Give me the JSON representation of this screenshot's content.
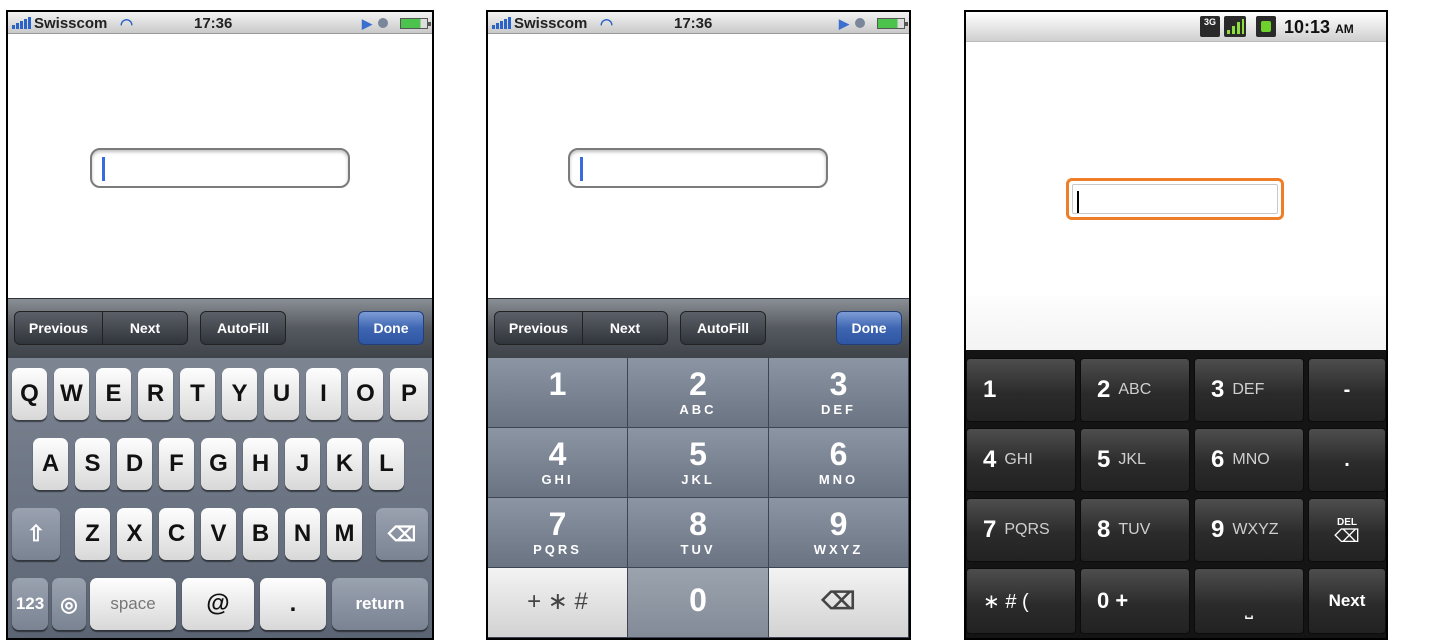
{
  "ios_status": {
    "carrier": "Swisscom",
    "time": "17:36"
  },
  "ios_toolbar": {
    "previous": "Previous",
    "next": "Next",
    "autofill": "AutoFill",
    "done": "Done"
  },
  "qwerty": {
    "row1": [
      "Q",
      "W",
      "E",
      "R",
      "T",
      "Y",
      "U",
      "I",
      "O",
      "P"
    ],
    "row2": [
      "A",
      "S",
      "D",
      "F",
      "G",
      "H",
      "J",
      "K",
      "L"
    ],
    "row3": [
      "Z",
      "X",
      "C",
      "V",
      "B",
      "N",
      "M"
    ],
    "bottom": {
      "numbers": "123",
      "space": "space",
      "at": "@",
      "dot": ".",
      "return": "return"
    }
  },
  "numpad": {
    "keys": [
      {
        "digit": "1",
        "letters": ""
      },
      {
        "digit": "2",
        "letters": "ABC"
      },
      {
        "digit": "3",
        "letters": "DEF"
      },
      {
        "digit": "4",
        "letters": "GHI"
      },
      {
        "digit": "5",
        "letters": "JKL"
      },
      {
        "digit": "6",
        "letters": "MNO"
      },
      {
        "digit": "7",
        "letters": "PQRS"
      },
      {
        "digit": "8",
        "letters": "TUV"
      },
      {
        "digit": "9",
        "letters": "WXYZ"
      }
    ],
    "symbols": "+ ∗ #",
    "zero": "0"
  },
  "android_status": {
    "network": "3G",
    "time": "10:13",
    "ampm": "AM"
  },
  "android_pad": {
    "keys": [
      {
        "digit": "1",
        "letters": ""
      },
      {
        "digit": "2",
        "letters": "ABC"
      },
      {
        "digit": "3",
        "letters": "DEF"
      },
      {
        "digit": "4",
        "letters": "GHI"
      },
      {
        "digit": "5",
        "letters": "JKL"
      },
      {
        "digit": "6",
        "letters": "MNO"
      },
      {
        "digit": "7",
        "letters": "PQRS"
      },
      {
        "digit": "8",
        "letters": "TUV"
      },
      {
        "digit": "9",
        "letters": "WXYZ"
      }
    ],
    "dash": "-",
    "dot": ".",
    "del": "DEL",
    "symbols": "∗ # (",
    "zero_plus": "0 +",
    "next": "Next"
  },
  "colors": {
    "ios_blue": "#3a6ae0",
    "android_orange": "#ef7e28",
    "done_blue": "#3f66b2"
  }
}
